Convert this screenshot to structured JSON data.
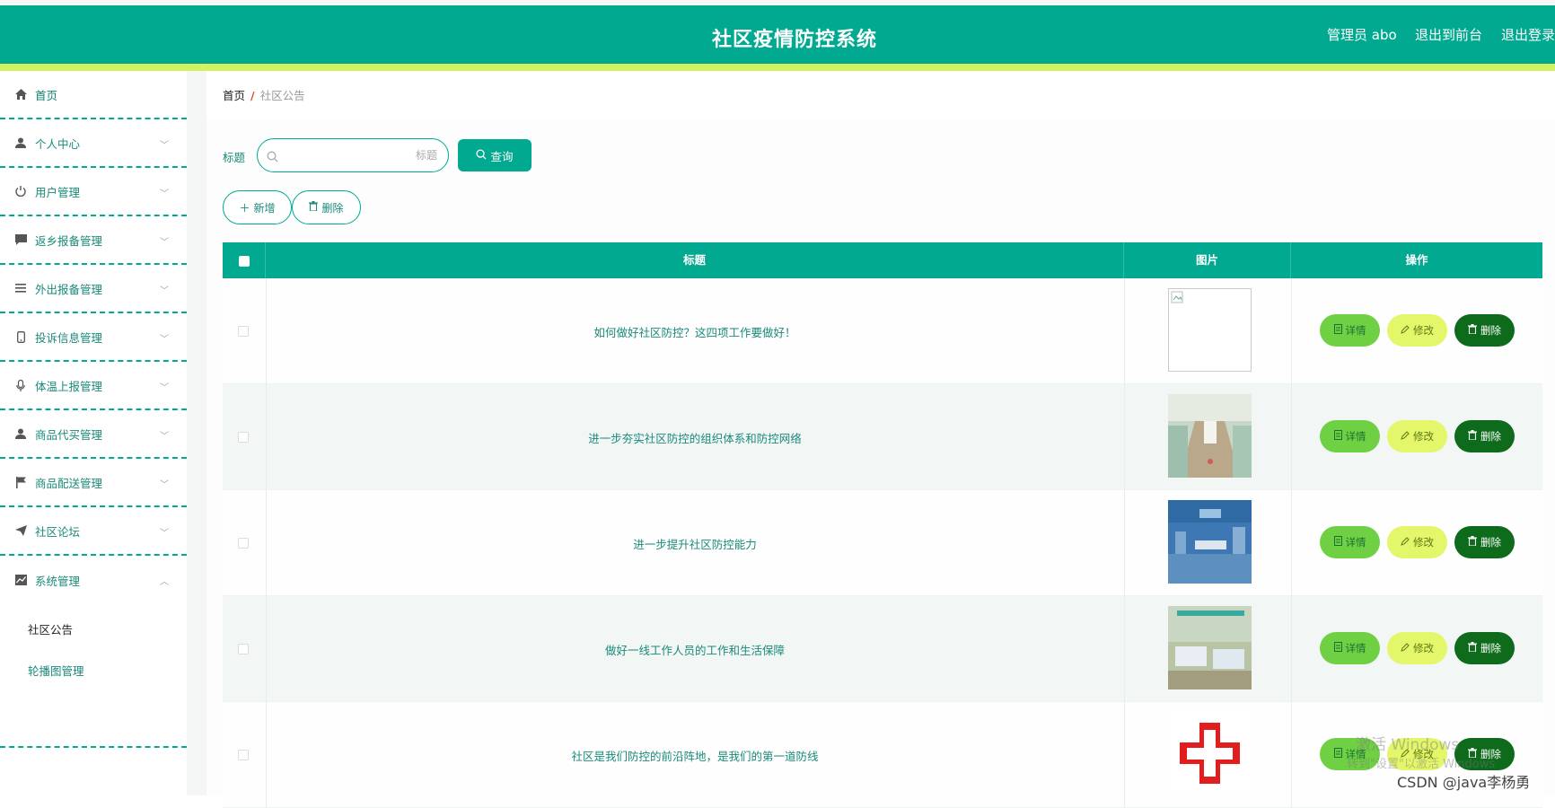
{
  "header": {
    "title": "社区疫情防控系统",
    "admin_label": "管理员 abo",
    "back_label": "退出到前台",
    "logout_label": "退出登录",
    "colors": {
      "primary": "#00a98f",
      "accent_bar": "#d4f160"
    }
  },
  "sidebar": {
    "items": [
      {
        "label": "首页",
        "icon": "home-icon"
      },
      {
        "label": "个人中心",
        "icon": "user-icon"
      },
      {
        "label": "用户管理",
        "icon": "power-icon"
      },
      {
        "label": "返乡报备管理",
        "icon": "chat-icon"
      },
      {
        "label": "外出报备管理",
        "icon": "menu-icon"
      },
      {
        "label": "投诉信息管理",
        "icon": "phone-icon"
      },
      {
        "label": "体温上报管理",
        "icon": "microphone-icon"
      },
      {
        "label": "商品代买管理",
        "icon": "person-icon"
      },
      {
        "label": "商品配送管理",
        "icon": "flag-icon"
      },
      {
        "label": "社区论坛",
        "icon": "send-icon"
      },
      {
        "label": "系统管理",
        "icon": "chart-icon"
      }
    ],
    "sub_items": [
      {
        "label": "社区公告"
      },
      {
        "label": "轮播图管理"
      }
    ]
  },
  "breadcrumb": {
    "home": "首页",
    "separator": "/",
    "current": "社区公告"
  },
  "search": {
    "label": "标题",
    "placeholder": "标题",
    "value": "",
    "query_button": "查询"
  },
  "toolbar": {
    "add_label": "新增",
    "delete_label": "删除"
  },
  "table": {
    "columns": [
      "标题",
      "图片",
      "操作"
    ],
    "actions": {
      "detail": "详情",
      "edit": "修改",
      "delete": "删除"
    },
    "rows": [
      {
        "title": "如何做好社区防控？这四项工作要做好！",
        "image": "broken-image"
      },
      {
        "title": "进一步夯实社区防控的组织体系和防控网络",
        "image": "hospital-corridor-photo"
      },
      {
        "title": "进一步提升社区防控能力",
        "image": "operating-room-photo"
      },
      {
        "title": "做好一线工作人员的工作和生活保障",
        "image": "hospital-ward-photo"
      },
      {
        "title": "社区是我们防控的前沿阵地，是我们的第一道防线",
        "image": "red-cross-logo"
      }
    ]
  },
  "overlay": {
    "activate_windows": "激活 Windows",
    "activate_windows_sub": "转到\"设置\"以激活 Windows",
    "csdn_credit": "CSDN @java李杨勇"
  }
}
